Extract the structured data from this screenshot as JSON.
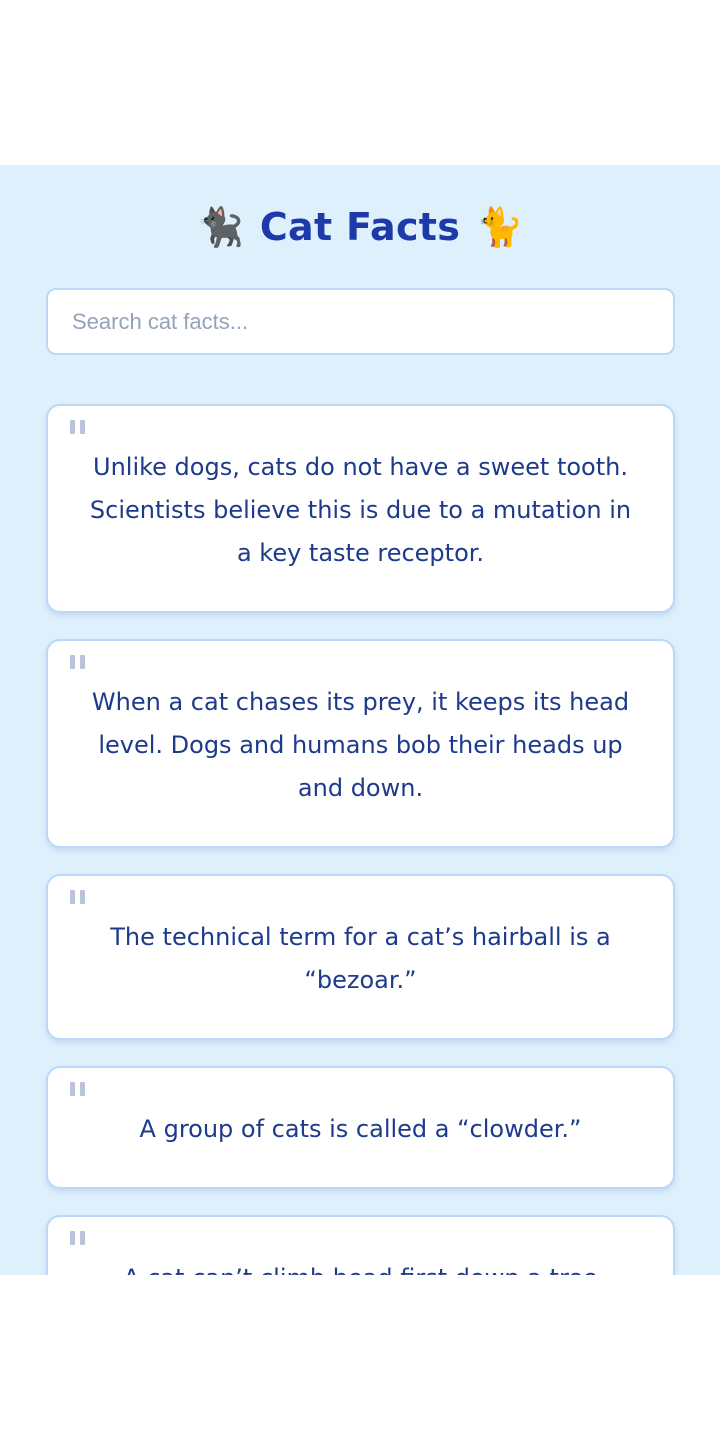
{
  "header": {
    "title": "Cat Facts",
    "left_emoji": "🐈‍⬛",
    "right_emoji": "🐈"
  },
  "search": {
    "placeholder": "Search cat facts...",
    "value": ""
  },
  "facts": [
    {
      "text": "Unlike dogs, cats do not have a sweet tooth. Scientists believe this is due to a mutation in a key taste receptor."
    },
    {
      "text": "When a cat chases its prey, it keeps its head level. Dogs and humans bob their heads up and down."
    },
    {
      "text": "The technical term for a cat’s hairball is a “bezoar.”"
    },
    {
      "text": "A group of cats is called a “clowder.”"
    },
    {
      "text": "A cat can’t climb head first down a tree"
    }
  ],
  "icons": {
    "quote": "quote-icon"
  },
  "colors": {
    "background": "#dff0fd",
    "title": "#1e3aa8",
    "fact_text": "#1e3a8a",
    "card_border": "#bcd8f6",
    "quote_mark": "#b9c4dc"
  }
}
